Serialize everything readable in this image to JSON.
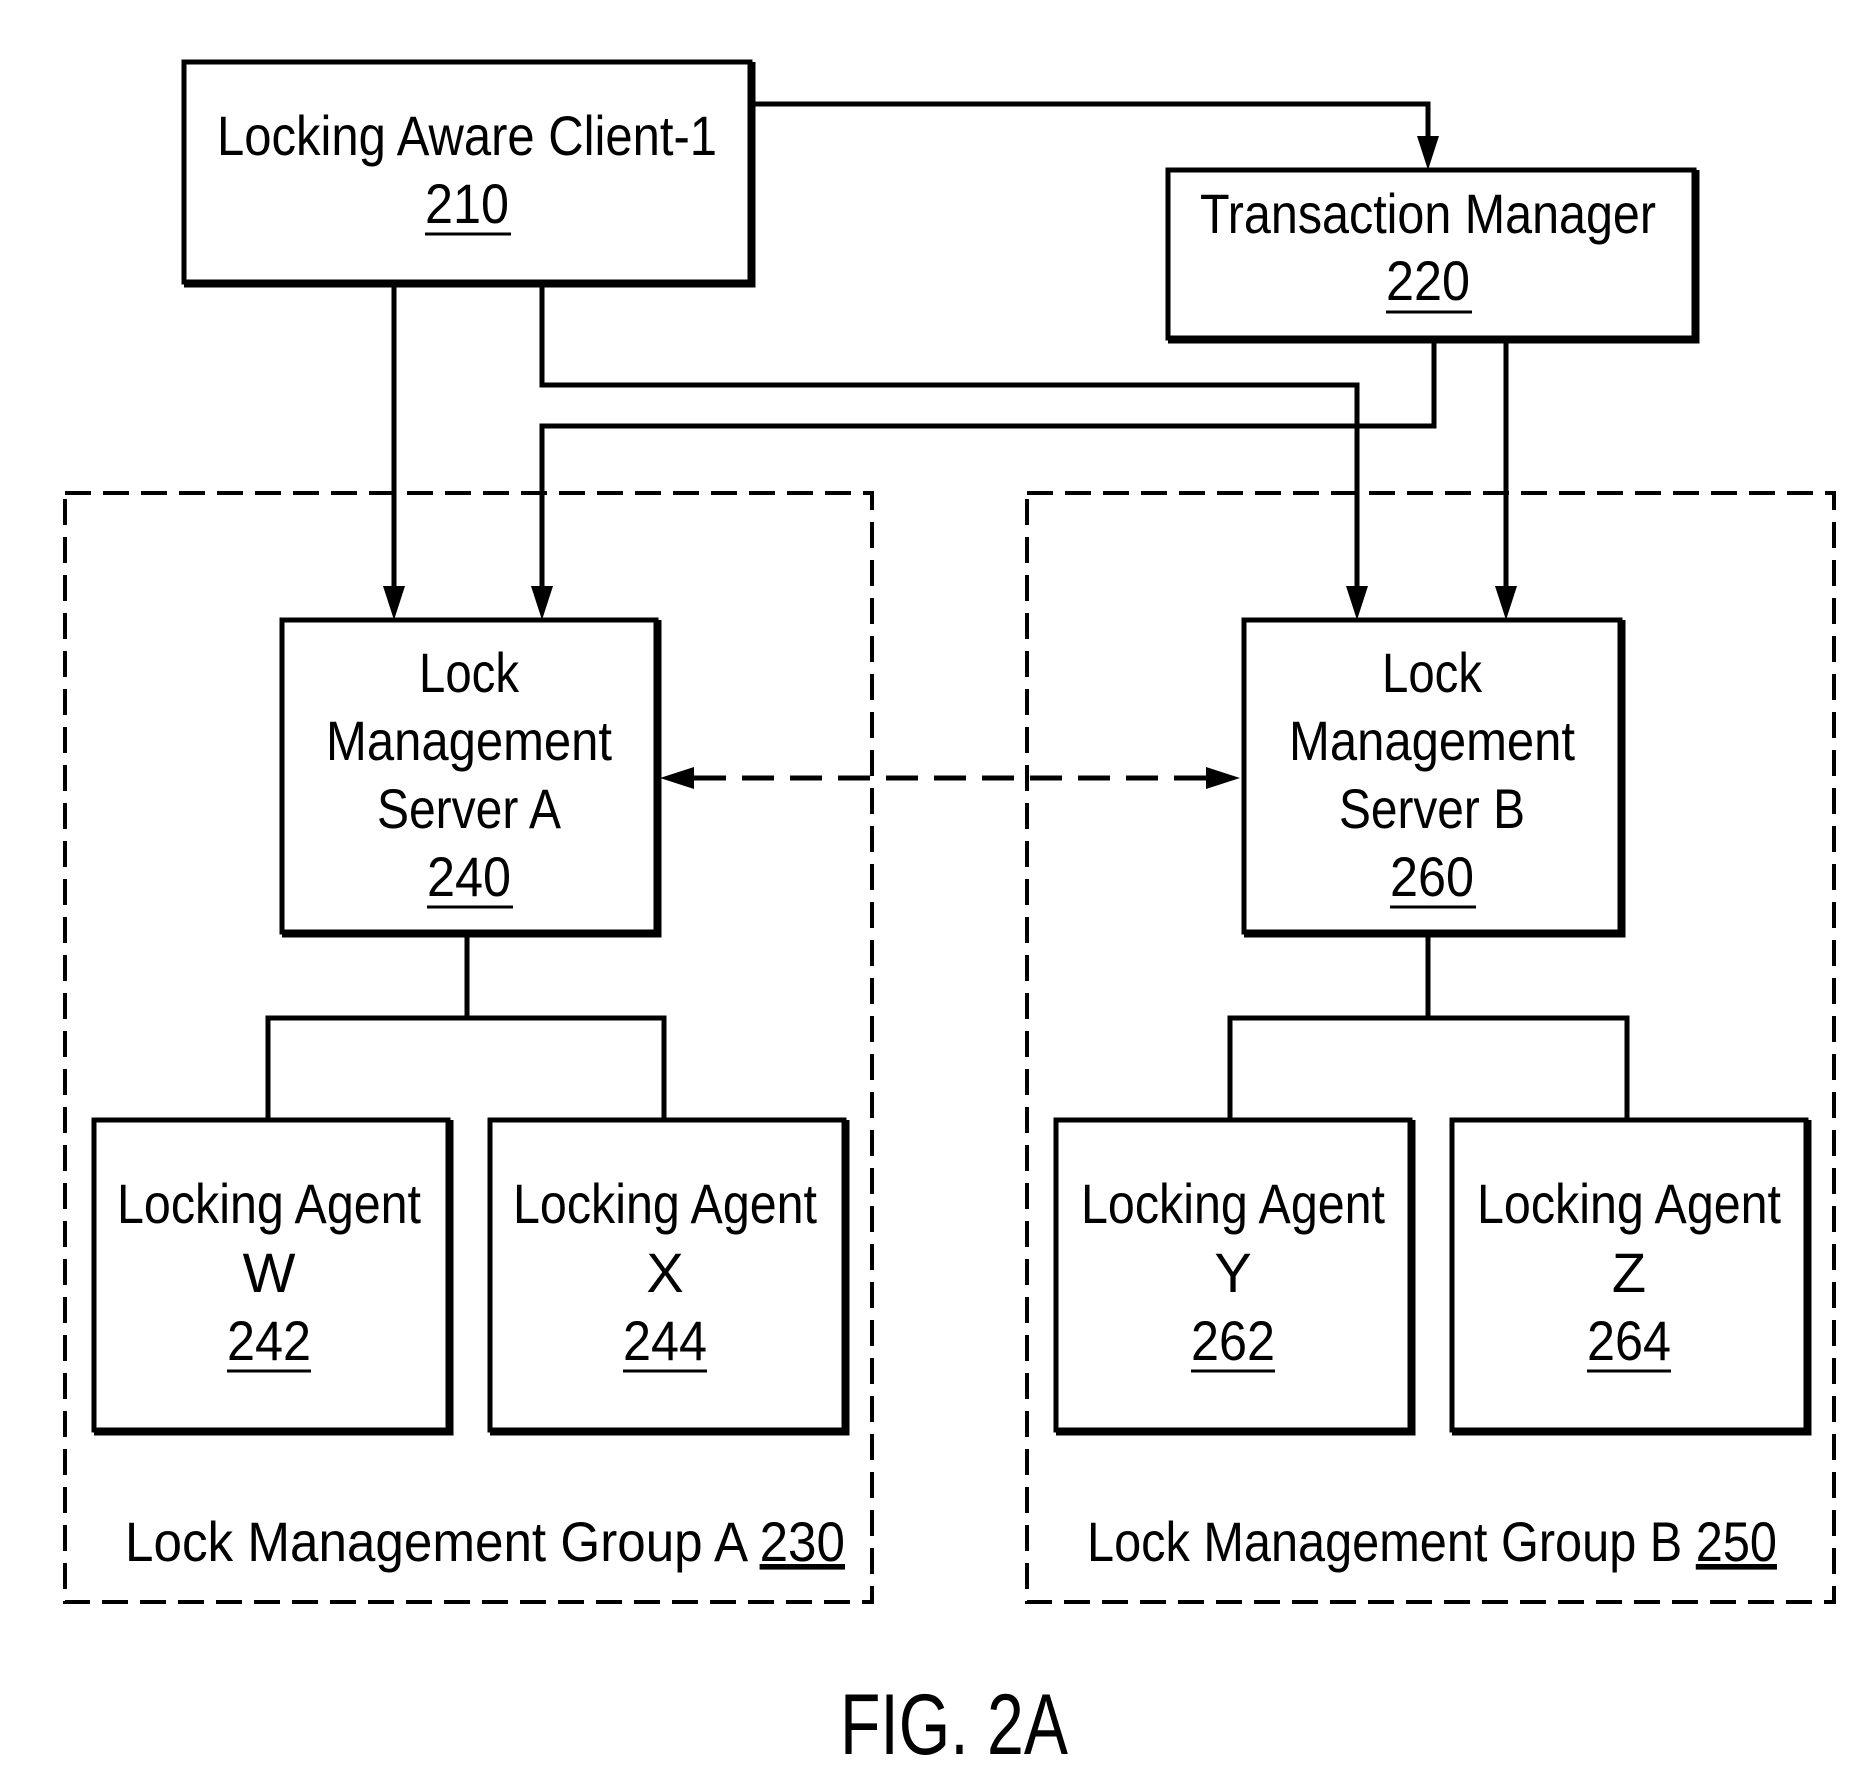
{
  "diagram": {
    "figure_label": "FIG. 2A",
    "nodes": {
      "client": {
        "title": "Locking Aware Client-1",
        "ref": "210"
      },
      "tm": {
        "title": "Transaction Manager",
        "ref": "220"
      },
      "lms_a": {
        "lines": [
          "Lock",
          "Management",
          "Server A"
        ],
        "ref": "240"
      },
      "lms_b": {
        "lines": [
          "Lock",
          "Management",
          "Server B"
        ],
        "ref": "260"
      },
      "agent_w": {
        "title": "Locking Agent",
        "letter": "W",
        "ref": "242"
      },
      "agent_x": {
        "title": "Locking Agent",
        "letter": "X",
        "ref": "244"
      },
      "agent_y": {
        "title": "Locking Agent",
        "letter": "Y",
        "ref": "262"
      },
      "agent_z": {
        "title": "Locking Agent",
        "letter": "Z",
        "ref": "264"
      }
    },
    "groups": {
      "group_a": {
        "title": "Lock Management Group A ",
        "ref": "230"
      },
      "group_b": {
        "title": "Lock Management Group B ",
        "ref": "250"
      }
    },
    "edges": [
      {
        "from": "210",
        "to": "220",
        "style": "solid",
        "arrow": "end"
      },
      {
        "from": "210",
        "to": "240",
        "style": "solid",
        "arrow": "end"
      },
      {
        "from": "210",
        "to": "260",
        "style": "solid",
        "arrow": "end"
      },
      {
        "from": "220",
        "to": "240",
        "style": "solid",
        "arrow": "end"
      },
      {
        "from": "220",
        "to": "260",
        "style": "solid",
        "arrow": "end"
      },
      {
        "from": "240",
        "to": "260",
        "style": "dashed",
        "arrow": "both"
      },
      {
        "from": "240",
        "to": "242",
        "style": "solid",
        "arrow": "none"
      },
      {
        "from": "240",
        "to": "244",
        "style": "solid",
        "arrow": "none"
      },
      {
        "from": "260",
        "to": "262",
        "style": "solid",
        "arrow": "none"
      },
      {
        "from": "260",
        "to": "264",
        "style": "solid",
        "arrow": "none"
      }
    ]
  }
}
